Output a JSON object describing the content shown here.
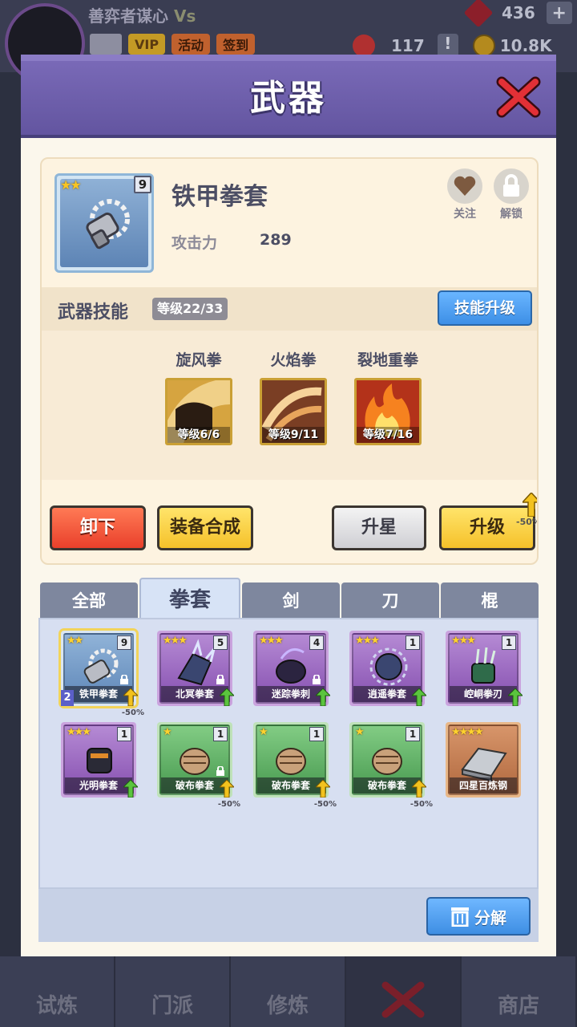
{
  "hud": {
    "player_name": "善弈者谋心",
    "player_name_suffix": "Vs",
    "vip_label": "VIP",
    "activity_label": "活动",
    "signin_label": "签到",
    "gems": "436",
    "plus": "+",
    "tokens": "117",
    "alert": "!",
    "coins": "10.8K"
  },
  "bottom_nav": [
    {
      "label": "试炼"
    },
    {
      "label": "门派"
    },
    {
      "label": "修炼"
    },
    {
      "label": ""
    },
    {
      "label": "商店"
    }
  ],
  "modal": {
    "title": "武器",
    "weapon": {
      "name": "铁甲拳套",
      "stars": "★★",
      "level": "9",
      "attr_label": "攻击力",
      "attr_value": "289",
      "follow_label": "关注",
      "unlock_label": "解锁"
    },
    "skills": {
      "title": "武器技能",
      "level": "等级22/33",
      "upgrade_label": "技能升级",
      "list": [
        {
          "name": "旋风拳",
          "level": "等级6/6"
        },
        {
          "name": "火焰拳",
          "level": "等级9/11"
        },
        {
          "name": "裂地重拳",
          "level": "等级7/16"
        }
      ]
    },
    "actions": {
      "unequip": "卸下",
      "synthesize": "装备合成",
      "star_up": "升星",
      "level_up": "升级",
      "discount": "-50%"
    },
    "tabs": [
      "全部",
      "拳套",
      "剑",
      "刀",
      "棍"
    ],
    "items": [
      {
        "name": "铁甲拳套",
        "stars": "★★",
        "num": "9",
        "badge": "2",
        "pct": "-50%"
      },
      {
        "name": "北冥拳套",
        "stars": "★★★",
        "num": "5"
      },
      {
        "name": "迷踪拳刺",
        "stars": "★★★",
        "num": "4"
      },
      {
        "name": "逍遥拳套",
        "stars": "★★★",
        "num": "1"
      },
      {
        "name": "崆峒拳刃",
        "stars": "★★★",
        "num": "1"
      },
      {
        "name": "光明拳套",
        "stars": "★★★",
        "num": "1"
      },
      {
        "name": "破布拳套",
        "stars": "★",
        "num": "1",
        "pct": "-50%"
      },
      {
        "name": "破布拳套",
        "stars": "★",
        "num": "1",
        "pct": "-50%"
      },
      {
        "name": "破布拳套",
        "stars": "★",
        "num": "1",
        "pct": "-50%"
      },
      {
        "name": "四星百炼钢",
        "stars": "★★★★"
      }
    ],
    "decompose_label": "分解"
  },
  "colors": {
    "header_purple": "#6b5caa",
    "card_cream": "#fdf3e0",
    "button_blue": "#3d8fe6",
    "button_red": "#e9402b",
    "button_yellow": "#f5c12a"
  }
}
